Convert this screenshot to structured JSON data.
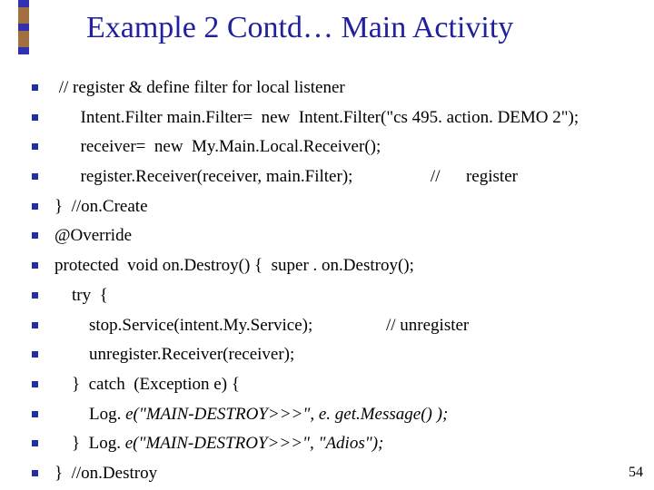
{
  "title": "Example 2 Contd… Main Activity",
  "lines": [
    {
      "text": " // register & define filter for local listener"
    },
    {
      "text": "      Intent.Filter main.Filter=  new  Intent.Filter(\"cs 495. action. DEMO 2\");"
    },
    {
      "text": "      receiver=  new  My.Main.Local.Receiver();"
    },
    {
      "text": "      register.Receiver(receiver, main.Filter);                  //      register"
    },
    {
      "text": "}  //on.Create"
    },
    {
      "text": "@Override"
    },
    {
      "text": "protected  void on.Destroy() {  super . on.Destroy();"
    },
    {
      "text": "    try  {"
    },
    {
      "text": "        stop.Service(intent.My.Service);                 // unregister"
    },
    {
      "text": "        unregister.Receiver(receiver);"
    },
    {
      "text": "    }  catch  (Exception e) {"
    },
    {
      "text": "        Log. ",
      "italic_suffix": "e(\"MAIN-DESTROY>>>\", e. get.Message() );"
    },
    {
      "text": "    }  Log. ",
      "italic_suffix": "e(\"MAIN-DESTROY>>>\", \"Adios\");"
    },
    {
      "text": "}  //on.Destroy"
    }
  ],
  "page_number": "54"
}
